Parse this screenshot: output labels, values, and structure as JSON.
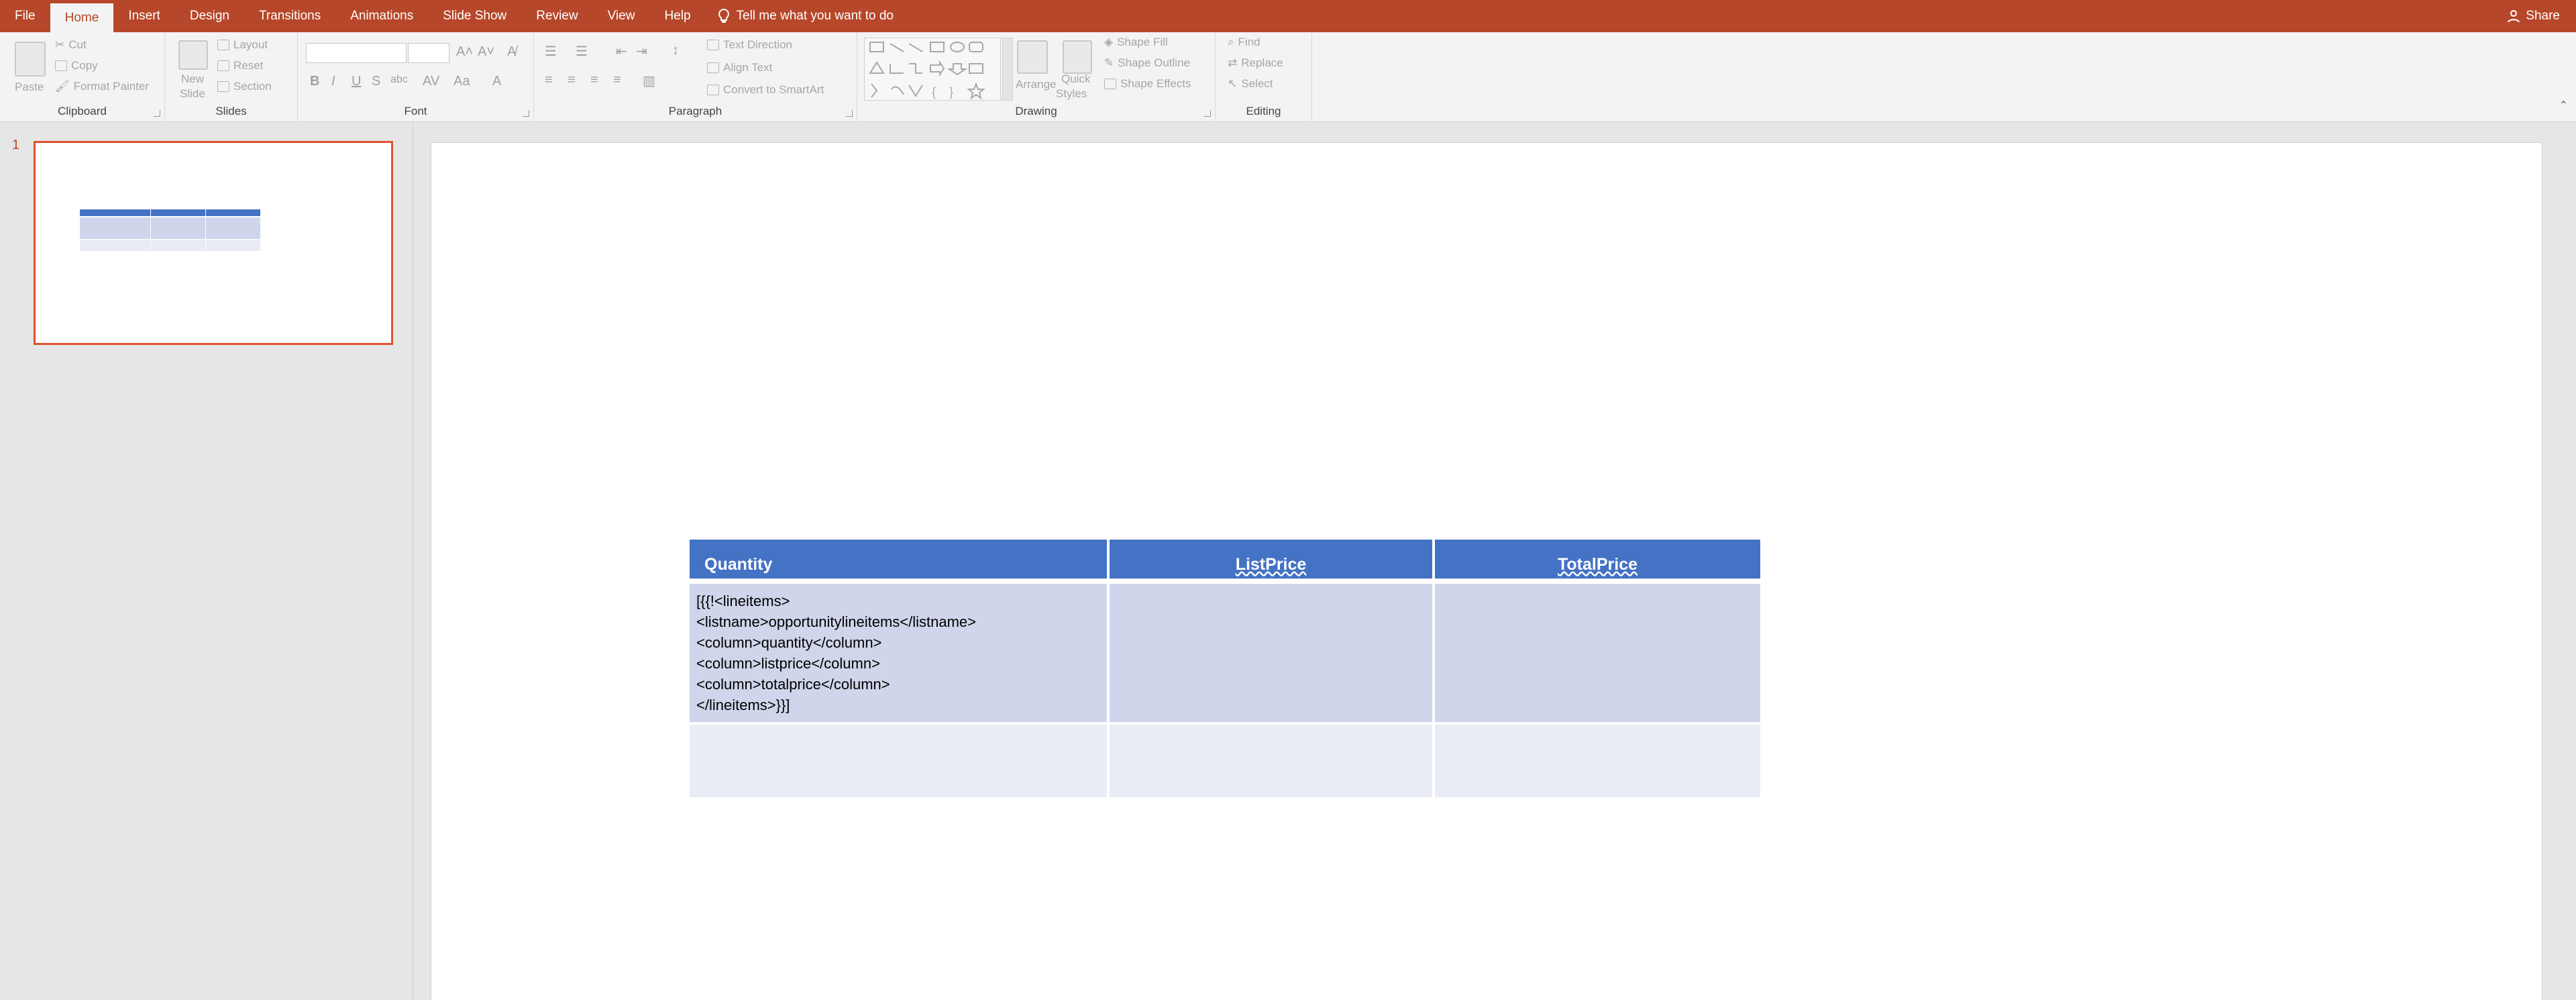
{
  "tabs": [
    {
      "label": "File",
      "active": false
    },
    {
      "label": "Home",
      "active": true
    },
    {
      "label": "Insert",
      "active": false
    },
    {
      "label": "Design",
      "active": false
    },
    {
      "label": "Transitions",
      "active": false
    },
    {
      "label": "Animations",
      "active": false
    },
    {
      "label": "Slide Show",
      "active": false
    },
    {
      "label": "Review",
      "active": false
    },
    {
      "label": "View",
      "active": false
    },
    {
      "label": "Help",
      "active": false
    }
  ],
  "tell_me": "Tell me what you want to do",
  "share": "Share",
  "ribbon": {
    "clipboard": {
      "label": "Clipboard",
      "paste": "Paste",
      "cut": "Cut",
      "copy": "Copy",
      "format_painter": "Format Painter"
    },
    "slides": {
      "label": "Slides",
      "new_slide_1": "New",
      "new_slide_2": "Slide",
      "layout": "Layout",
      "reset": "Reset",
      "section": "Section"
    },
    "font": {
      "label": "Font"
    },
    "paragraph": {
      "label": "Paragraph",
      "text_direction": "Text Direction",
      "align_text": "Align Text",
      "convert_smartart": "Convert to SmartArt"
    },
    "drawing": {
      "label": "Drawing",
      "arrange": "Arrange",
      "quick_1": "Quick",
      "quick_2": "Styles",
      "shape_fill": "Shape Fill",
      "shape_outline": "Shape Outline",
      "shape_effects": "Shape Effects"
    },
    "editing": {
      "label": "Editing",
      "find": "Find",
      "replace": "Replace",
      "select": "Select"
    }
  },
  "thumbnails": [
    {
      "number": "1"
    }
  ],
  "table": {
    "headers": [
      "Quantity",
      "ListPrice",
      "TotalPrice"
    ],
    "row1_col1_lines": [
      "[{{!<lineitems>",
      "<listname>opportunitylineitems</listname>",
      "<column>quantity</column>",
      "<column>listprice</column>",
      "<column>totalprice</column>",
      "</lineitems>}}]"
    ]
  },
  "colors": {
    "accent": "#b7472a",
    "header_blue": "#4472c4",
    "row_dark": "#cfd5ea",
    "row_light": "#e9ebf5",
    "thumb_border": "#e0522d"
  }
}
